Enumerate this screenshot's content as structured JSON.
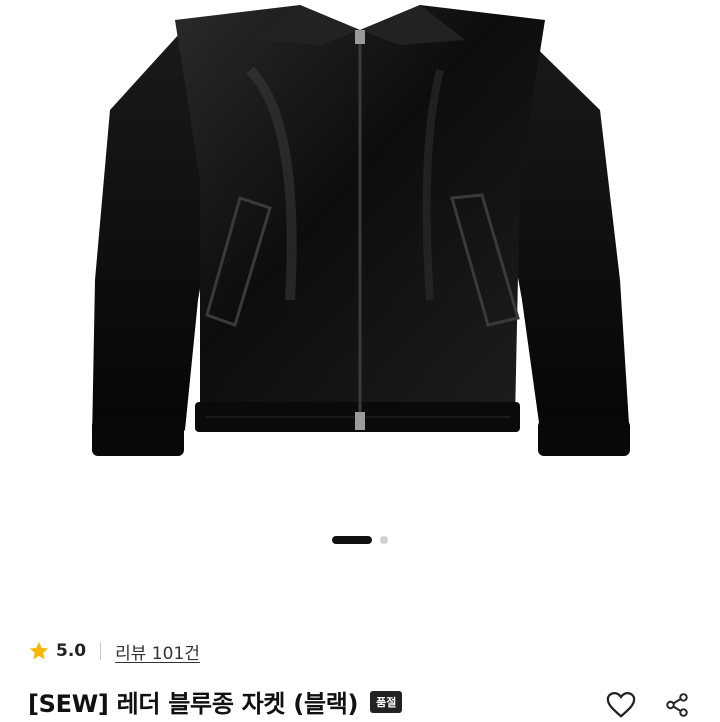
{
  "product": {
    "image_alt": "black leather blouson jacket",
    "title": "[SEW] 레더 블루종 자켓 (블랙)",
    "status_badge": "품절",
    "rating": "5.0",
    "review_label": "리뷰 101건"
  },
  "carousel": {
    "active_index": 1,
    "total": 2
  },
  "icons": {
    "rating_star": "star-icon",
    "like": "heart-icon",
    "share": "share-icon"
  },
  "colors": {
    "star": "#f5b800",
    "text": "#111111",
    "badge_bg": "#222222"
  }
}
